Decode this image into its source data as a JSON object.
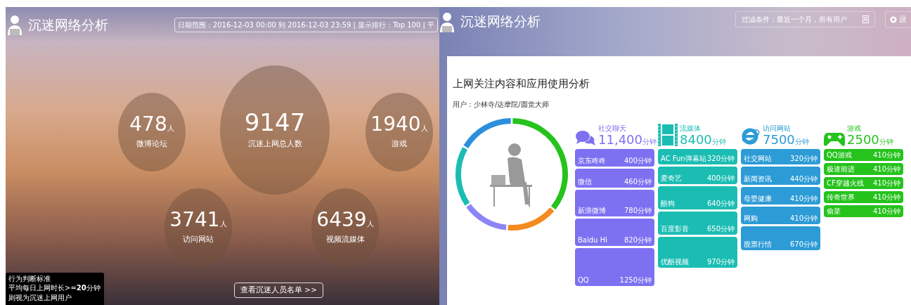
{
  "left": {
    "app_title": "沉迷网络分析",
    "date_filter": "日期范围：2016-12-03 00:00 到 2016-12-03 23:59 | 显示排行：Top 100 | 平",
    "bubbles": [
      {
        "kind": "small",
        "value": "478",
        "unit": "人",
        "label": "微博论坛"
      },
      {
        "kind": "main",
        "value": "9147",
        "label": "沉迷上网总人数"
      },
      {
        "kind": "small",
        "value": "1940",
        "unit": "人",
        "label": "游戏"
      },
      {
        "kind": "small",
        "value": "3741",
        "unit": "人",
        "label": "访问网站"
      },
      {
        "kind": "small",
        "value": "6439",
        "unit": "人",
        "label": "视频流媒体"
      }
    ],
    "criteria": {
      "title": "行为判断标准",
      "rule": "平均每日上网时长>=**20**分钟",
      "note": "则视为沉迷上网用户"
    },
    "list_button": "查看沉迷人员名单 >>"
  },
  "right": {
    "app_title": "沉迷网络分析",
    "filter": "过滤条件：最近一个月，所有用户",
    "settings_button": "设",
    "title": "上网关注内容和应用使用分析",
    "user": "用户：少林寺/达摩院/圆觉大师",
    "categories": [
      {
        "kind": "chat",
        "color": "#7d71f2",
        "label": "社交聊天",
        "total": "11,400",
        "unit": "分钟",
        "items": [
          {
            "name": "京东咚咚",
            "minutes": "400分钟"
          },
          {
            "name": "微信",
            "minutes": "460分钟"
          },
          {
            "name": "新浪微博",
            "minutes": "780分钟"
          },
          {
            "name": "Baidu Hi",
            "minutes": "820分钟"
          },
          {
            "name": "QQ",
            "minutes": "1250分钟"
          }
        ]
      },
      {
        "kind": "video",
        "color": "#1bbdb3",
        "label": "流媒体",
        "total": "8400",
        "unit": "分钟",
        "items": [
          {
            "name": "AC Fun弹幕站",
            "minutes": "320分钟"
          },
          {
            "name": "爱奇艺",
            "minutes": "400分钟"
          },
          {
            "name": "酷狗",
            "minutes": "640分钟"
          },
          {
            "name": "百度影音",
            "minutes": "650分钟"
          },
          {
            "name": "优酷视频",
            "minutes": "970分钟"
          }
        ]
      },
      {
        "kind": "web",
        "color": "#2c9bd6",
        "label": "访问网站",
        "total": "7500",
        "unit": "分钟",
        "items": [
          {
            "name": "社交网站",
            "minutes": "320分钟"
          },
          {
            "name": "新闻资讯",
            "minutes": "440分钟"
          },
          {
            "name": "母婴健康",
            "minutes": "410分钟"
          },
          {
            "name": "网购",
            "minutes": "410分钟"
          },
          {
            "name": "股票行情",
            "minutes": "670分钟"
          }
        ]
      },
      {
        "kind": "game",
        "color": "#25c31c",
        "label": "游戏",
        "total": "2500",
        "unit": "分钟",
        "items": [
          {
            "name": "QQ游戏",
            "minutes": "410分钟"
          },
          {
            "name": "极速前进",
            "minutes": "410分钟"
          },
          {
            "name": "CF穿越火线",
            "minutes": "410分钟"
          },
          {
            "name": "传奇世界",
            "minutes": "410分钟"
          },
          {
            "name": "偷菜",
            "minutes": "410分钟"
          }
        ]
      }
    ]
  }
}
